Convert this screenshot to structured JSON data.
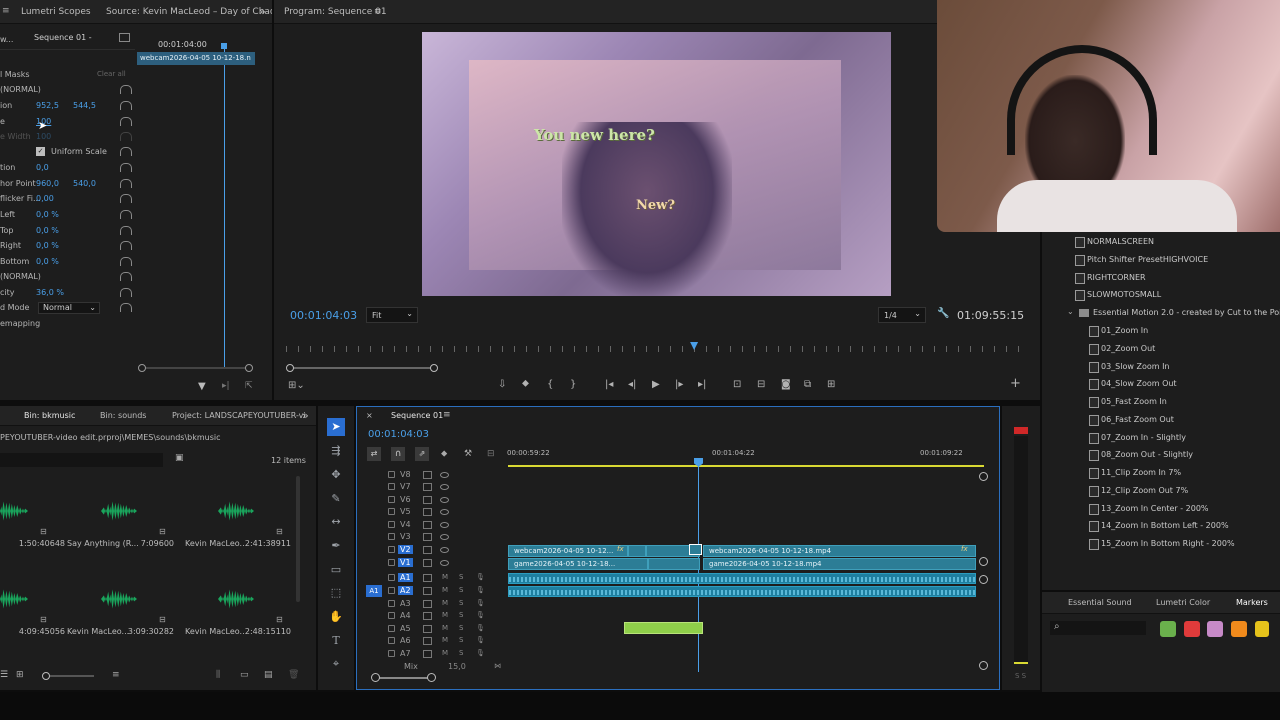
{
  "panels": {
    "lumetri_tab": "Lumetri Scopes",
    "source_tab": "Source: Kevin MacLeod – Day of Chaos -",
    "program_tab": "Program: Sequence 01"
  },
  "effect_controls": {
    "seq_label": "Sequence 01 -",
    "mini_timecode": "00:01:04:00",
    "clip_name": "webcam2026-04-05 10-12-18.n",
    "masks_label": "l Masks",
    "clear_all": "Clear all",
    "rows": [
      {
        "label": "(NORMAL)",
        "v1": "",
        "v2": ""
      },
      {
        "label": "ion",
        "v1": "952,5",
        "v2": "544,5"
      },
      {
        "label": "e",
        "v1": "100",
        "v2": ""
      },
      {
        "label": "e Width",
        "v1": "100",
        "v2": ""
      },
      {
        "label": "",
        "v1": "Uniform Scale",
        "v2": ""
      },
      {
        "label": "tion",
        "v1": "0,0",
        "v2": ""
      },
      {
        "label": "hor Point",
        "v1": "960,0",
        "v2": "540,0"
      },
      {
        "label": "flicker Fi...",
        "v1": "0,00",
        "v2": ""
      },
      {
        "label": "Left",
        "v1": "0,0 %",
        "v2": ""
      },
      {
        "label": "Top",
        "v1": "0,0 %",
        "v2": ""
      },
      {
        "label": "Right",
        "v1": "0,0 %",
        "v2": ""
      },
      {
        "label": "Bottom",
        "v1": "0,0 %",
        "v2": ""
      },
      {
        "label": "(NORMAL)",
        "v1": "",
        "v2": ""
      },
      {
        "label": "city",
        "v1": "36,0 %",
        "v2": ""
      },
      {
        "label": "d Mode",
        "v1": "Normal",
        "v2": ""
      },
      {
        "label": "emapping",
        "v1": "",
        "v2": ""
      }
    ]
  },
  "program": {
    "overlay_text_1": "You new here?",
    "overlay_text_2": "New?",
    "current_time": "00:01:04:03",
    "fit": "Fit",
    "resolution": "1/4",
    "duration": "01:09:55:15",
    "playhead_fraction": 0.55
  },
  "project": {
    "tab_bin": "Bin: bkmusic",
    "tab_sounds": "Bin: sounds",
    "tab_project": "Project: LANDSCAPEYOUTUBER-vi",
    "path": "PEYOUTUBER-video edit.prproj\\MEMES\\sounds\\bkmusic",
    "items_count": "12 items",
    "items": [
      {
        "name": "",
        "duration": "1:50:40648"
      },
      {
        "name": "Say Anything (R...",
        "duration": "7:09600"
      },
      {
        "name": "Kevin MacLeo...",
        "duration": "2:41:38911"
      },
      {
        "name": "",
        "duration": "4:09:45056"
      },
      {
        "name": "Kevin MacLeo...",
        "duration": "3:09:30282"
      },
      {
        "name": "Kevin MacLeo...",
        "duration": "2:48:15110"
      }
    ]
  },
  "timeline": {
    "tab": "Sequence 01",
    "current_time": "00:01:04:03",
    "ruler": [
      "00:00:59:22",
      "00:01:04:22",
      "00:01:09:22"
    ],
    "video_tracks": [
      "V8",
      "V7",
      "V6",
      "V5",
      "V4",
      "V3",
      "V2",
      "V1"
    ],
    "audio_tracks": [
      "A1",
      "A2",
      "A3",
      "A4",
      "A5",
      "A6",
      "A7"
    ],
    "mix_label": "Mix",
    "mix_value": "15,0",
    "clips": {
      "v2_left": "webcam2026-04-05 10-12...",
      "v2_right": "webcam2026-04-05 10-12-18.mp4",
      "v1_left": "game2026-04-05 10-12-18...",
      "v1_right": "game2026-04-05 10-12-18.mp4"
    }
  },
  "effects": {
    "items_top": [
      "NORMALSCREEN",
      "Pitch Shifter PresetHIGHVOICE",
      "RIGHTCORNER",
      "SLOWMOTOSMALL"
    ],
    "folder": "Essential Motion 2.0 - created by Cut to the Point",
    "presets": [
      "01_Zoom In",
      "02_Zoom Out",
      "03_Slow Zoom In",
      "04_Slow Zoom Out",
      "05_Fast Zoom In",
      "06_Fast Zoom Out",
      "07_Zoom In - Slightly",
      "08_Zoom Out - Slightly",
      "11_Clip Zoom In 7%",
      "12_Clip Zoom Out 7%",
      "13_Zoom In Center - 200%",
      "14_Zoom In Bottom Left - 200%",
      "15_Zoom In Bottom Right - 200%"
    ]
  },
  "bottom_tabs": [
    "Essential Sound",
    "Lumetri Color",
    "Markers"
  ],
  "meter_label": "S S",
  "colors": {
    "accent": "#4a9fe8",
    "panel": "#1d1d1d",
    "clip_video": "#2c7d96",
    "clip_audio": "#1e7fa0",
    "marker_swatches": [
      "#6ab04c",
      "#e03b3b",
      "#c78ac8",
      "#f08a1c",
      "#e5c21b"
    ]
  }
}
